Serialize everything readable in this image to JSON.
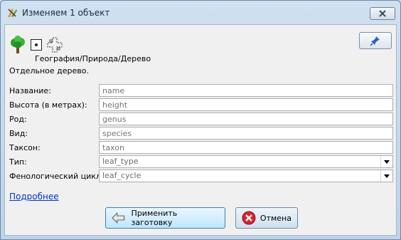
{
  "window": {
    "title": "Изменяем 1 объект"
  },
  "preset": {
    "path": "География/Природа/Дерево",
    "description": "Отдельное дерево.",
    "icons": [
      "tree-icon",
      "node-icon",
      "cross-icon"
    ]
  },
  "fields": [
    {
      "label": "Название:",
      "placeholder": "name",
      "type": "text"
    },
    {
      "label": "Высота (в метрах):",
      "placeholder": "height",
      "type": "text"
    },
    {
      "label": "Род:",
      "placeholder": "genus",
      "type": "text"
    },
    {
      "label": "Вид:",
      "placeholder": "species",
      "type": "text"
    },
    {
      "label": "Таксон:",
      "placeholder": "taxon",
      "type": "text"
    },
    {
      "label": "Тип:",
      "value": "leaf_type",
      "type": "combo"
    },
    {
      "label": "Фенологический цикл:",
      "value": "leaf_cycle",
      "type": "combo"
    }
  ],
  "more_link": "Подробнее",
  "buttons": {
    "apply_label": "Применить заготовку",
    "cancel_label": "Отмена"
  },
  "colors": {
    "link": "#0033cc",
    "cancel_icon": "#d9232d"
  }
}
